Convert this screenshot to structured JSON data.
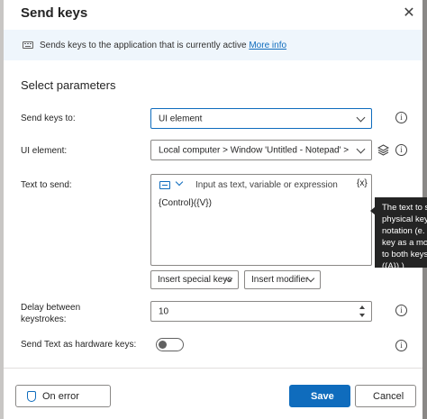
{
  "dialog": {
    "title": "Send keys",
    "close_glyph": "✕"
  },
  "info": {
    "text": "Sends keys to the application that is currently active ",
    "link": "More info",
    "icon": "keyboard-icon"
  },
  "section": {
    "title": "Select parameters"
  },
  "fields": {
    "send_keys_to": {
      "label": "Send keys to:",
      "value": "UI element"
    },
    "ui_element": {
      "label": "UI element:",
      "value": "Local computer > Window 'Untitled - Notepad' > Do",
      "layers_icon": "layers-icon"
    },
    "text_to_send": {
      "label": "Text to send:",
      "placeholder": "Input as text, variable or expression",
      "var_button": "{x}",
      "value": "{Control}({V})",
      "insert_special_keys": "Insert special keys",
      "insert_modifier": "Insert modifier"
    },
    "delay": {
      "label_line1": "Delay between",
      "label_line2": "keystrokes:",
      "value": "10"
    },
    "hardware_keys": {
      "label": "Send Text as hardware keys:",
      "checked": false
    }
  },
  "tooltip": {
    "lines": [
      "The text to s",
      "physical key",
      "notation (e.",
      "key as a mo",
      "to both keys",
      "({A}) )."
    ]
  },
  "footer": {
    "on_error": "On error",
    "save": "Save",
    "cancel": "Cancel"
  },
  "colors": {
    "accent": "#0f6cbd",
    "banner": "#eff6fc",
    "tooltip_bg": "#242424"
  }
}
